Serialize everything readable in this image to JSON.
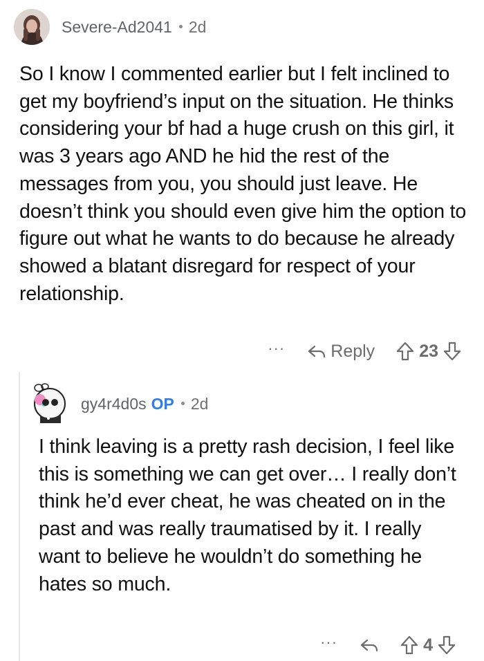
{
  "comments": [
    {
      "username": "Severe-Ad2041",
      "time": "2d",
      "body": "So I know I commented earlier but I felt inclined to get my boyfriend’s input on the situation. He thinks considering your bf had a huge crush on this girl, it was 3 years ago AND he hid the rest of the messages from you, you should just leave. He doesn’t think you should even give him the option to figure out what he wants to do because he already showed a blatant disregard for respect of your relationship.",
      "more": "···",
      "reply_label": "Reply",
      "score": "23"
    },
    {
      "username": "gy4r4d0s",
      "op": "OP",
      "time": "2d",
      "body": "I think leaving is a pretty rash decision, I feel like this is something we can get over… I really don’t think he’d ever cheat, he was cheated on in the past and was really traumatised by it. I really want to believe he wouldn’t do something he hates so much.",
      "more": "···",
      "score": "4"
    }
  ],
  "icons": {
    "reply": "reply-arrow-icon",
    "upvote": "upvote-arrow-icon",
    "downvote": "downvote-arrow-icon",
    "more": "more-dots-icon"
  },
  "colors": {
    "op_badge": "#2f7fe2",
    "meta": "#7c7c7c",
    "body": "#111111"
  }
}
